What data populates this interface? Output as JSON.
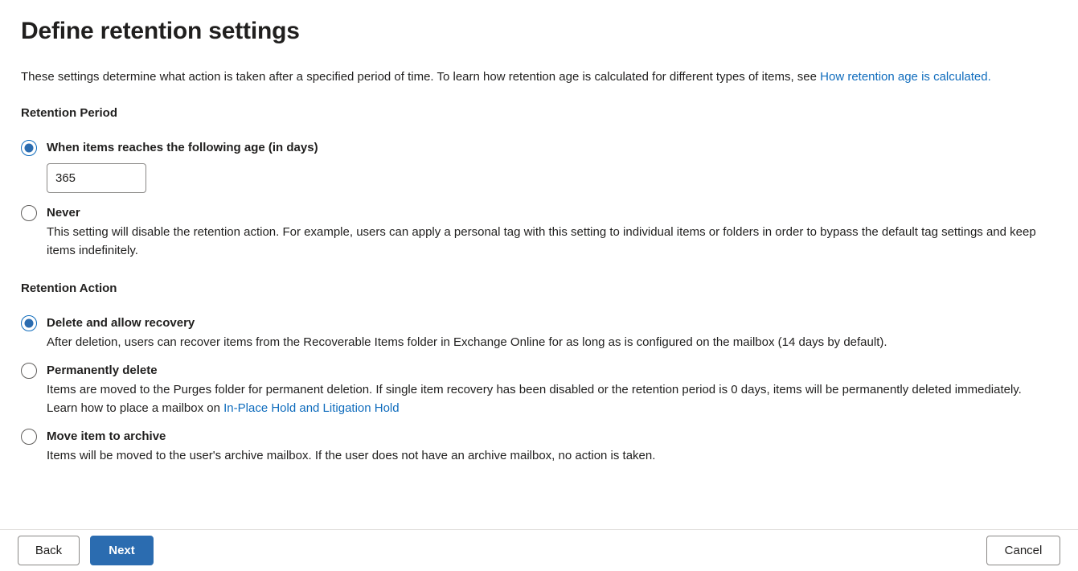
{
  "page": {
    "title": "Define retention settings",
    "intro_before_link": "These settings determine what action is taken after a specified period of time. To learn how retention age is calculated for different types of items, see ",
    "intro_link": "How retention age is calculated.",
    "intro_after_link": ""
  },
  "retention_period": {
    "heading": "Retention Period",
    "options": [
      {
        "label": "When items reaches the following age (in days)",
        "selected": true,
        "input_value": "365",
        "input_placeholder": ""
      },
      {
        "label": "Never",
        "selected": false,
        "description": "This setting will disable the retention action. For example, users can apply a personal tag with this setting to individual items or folders in order to bypass the default tag settings and keep items indefinitely."
      }
    ]
  },
  "retention_action": {
    "heading": "Retention Action",
    "options": [
      {
        "label": "Delete and allow recovery",
        "selected": true,
        "description": "After deletion, users can recover items from the Recoverable Items folder in Exchange Online for as long as is configured on the mailbox (14 days by default)."
      },
      {
        "label": "Permanently delete",
        "selected": false,
        "description_before_link": "Items are moved to the Purges folder for permanent deletion. If single item recovery has been disabled or the retention period is 0 days, items will be permanently deleted immediately. Learn how to place a mailbox on ",
        "description_link": "In-Place Hold and Litigation Hold"
      },
      {
        "label": "Move item to archive",
        "selected": false,
        "description": "Items will be moved to the user's archive mailbox. If the user does not have an archive mailbox, no action is taken."
      }
    ]
  },
  "footer": {
    "back_label": "Back",
    "next_label": "Next",
    "cancel_label": "Cancel"
  },
  "colors": {
    "accent": "#2b6cb0",
    "link": "#0f6cbd",
    "text": "#201f1e",
    "border": "#8a8886"
  }
}
